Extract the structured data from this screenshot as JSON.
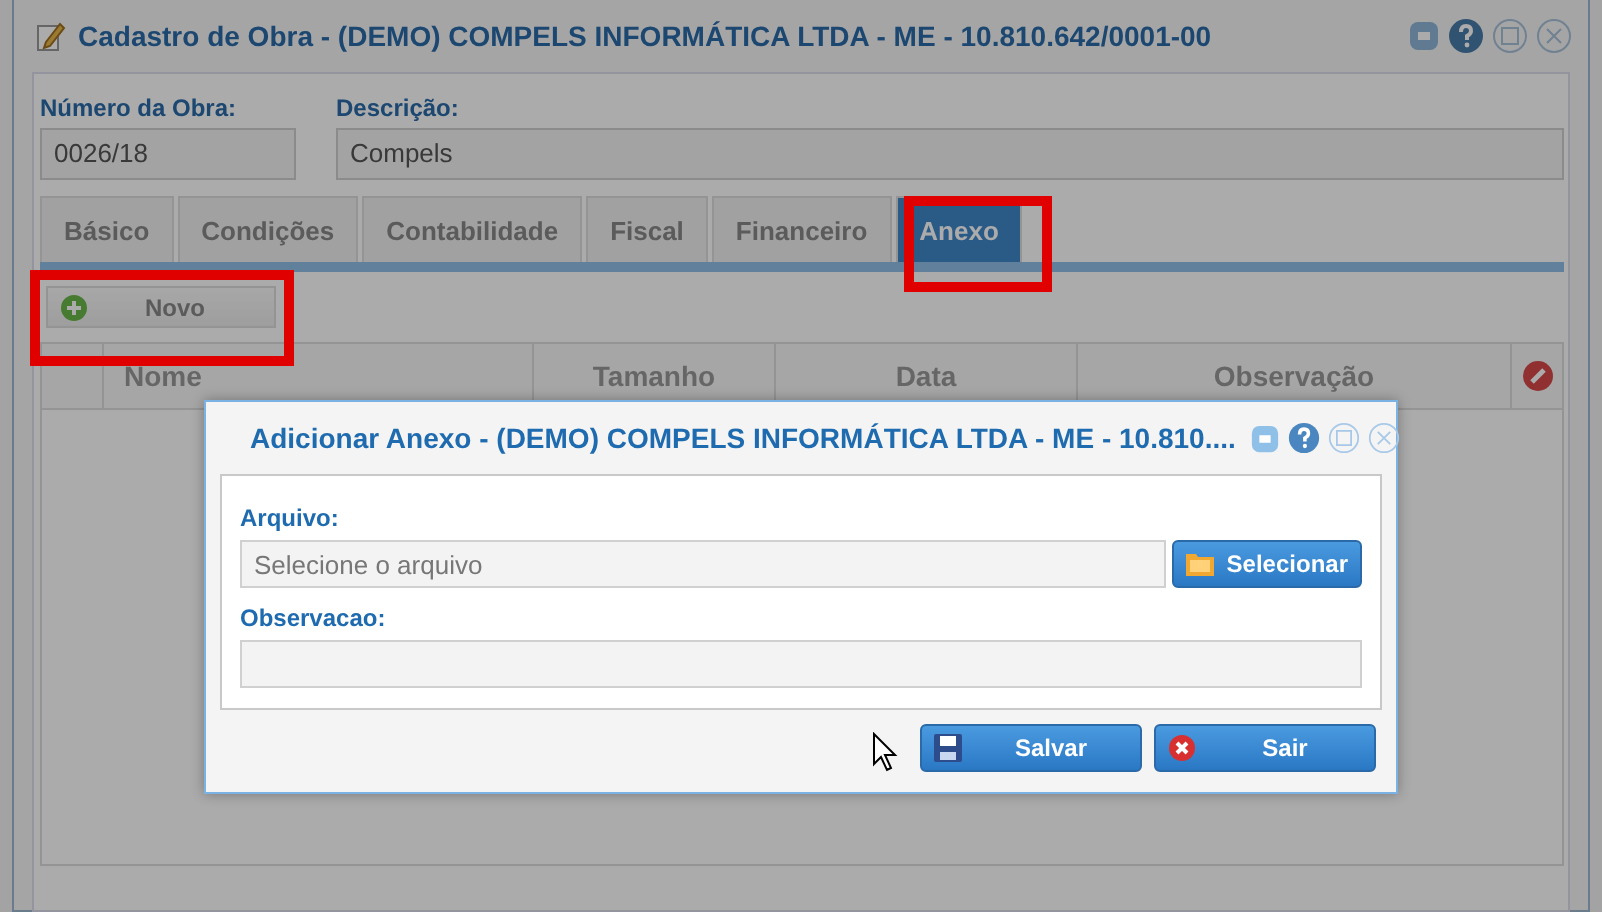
{
  "window": {
    "title": "Cadastro de Obra - (DEMO) COMPELS INFORMÁTICA LTDA - ME - 10.810.642/0001-00"
  },
  "fields": [
    {
      "label": "Número da Obra:",
      "value": "0026/18"
    },
    {
      "label": "Descrição:",
      "value": "Compels"
    }
  ],
  "tabs": [
    {
      "label": "Básico",
      "selected": false,
      "highlighted": false
    },
    {
      "label": "Condições",
      "selected": false,
      "highlighted": false
    },
    {
      "label": "Contabilidade",
      "selected": false,
      "highlighted": false
    },
    {
      "label": "Fiscal",
      "selected": false,
      "highlighted": false
    },
    {
      "label": "Financeiro",
      "selected": false,
      "highlighted": false
    },
    {
      "label": "Anexo",
      "selected": true,
      "highlighted": true
    }
  ],
  "new_button": {
    "label": "Novo",
    "highlighted": true
  },
  "table": {
    "columns": [
      "Nome",
      "Tamanho",
      "Data",
      "Observação"
    ]
  },
  "dialog": {
    "title": "Adicionar Anexo - (DEMO) COMPELS INFORMÁTICA LTDA - ME - 10.810....",
    "file_label": "Arquivo:",
    "file_placeholder": "Selecione o arquivo",
    "select_button": "Selecionar",
    "note_label": "Observacao:",
    "buttons": [
      {
        "kind": "save",
        "label": "Salvar"
      },
      {
        "kind": "exit",
        "label": "Sair"
      }
    ]
  }
}
